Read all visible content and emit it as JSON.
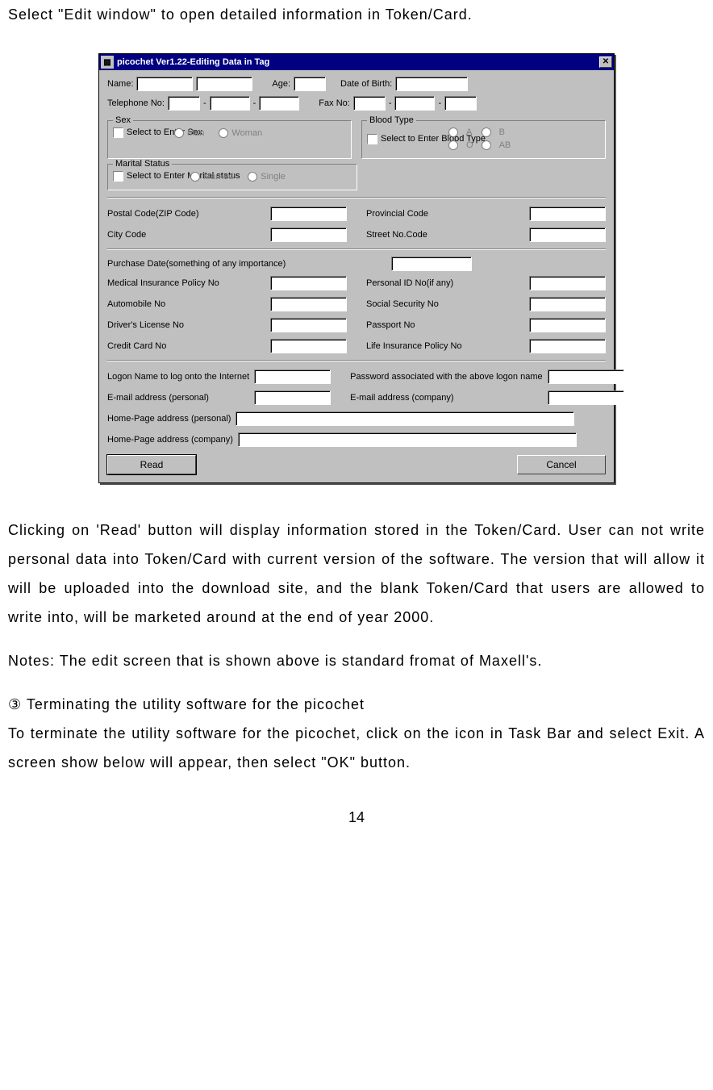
{
  "doc": {
    "intro": "Select \"Edit window\" to open detailed information in Token/Card.",
    "para1": "Clicking on 'Read' button will display information stored in the Token/Card. User can not write personal data into Token/Card with current version of the software. The version that will allow it will be uploaded into the download site, and the blank Token/Card that users are allowed to write into, will be marketed around at the end of year 2000.",
    "notes": "Notes: The edit screen that is shown above is standard fromat of Maxell's.",
    "term_heading": "③ Terminating the utility software for the picochet",
    "term_body": "To terminate the utility software for the picochet, click on the icon in Task Bar and select Exit.  A screen show below will appear, then select \"OK\" button.",
    "page": "14"
  },
  "dialog": {
    "title": "picochet Ver1.22-Editing Data in Tag",
    "labels": {
      "name": "Name:",
      "age": "Age:",
      "dob": "Date of Birth:",
      "tel": "Telephone No:",
      "fax": "Fax No:",
      "sex": "Sex",
      "sex_chk": "Select to Enter Sex",
      "man": "Man",
      "woman": "Woman",
      "blood": "Blood Type",
      "blood_chk": "Select to Enter Blood Type",
      "a": "A",
      "b": "B",
      "o": "O",
      "ab": "AB",
      "marital": "Marital Status",
      "marital_chk": "Select to Enter Marital status",
      "married": "Married",
      "single": "Single",
      "postal": "Postal Code(ZIP Code)",
      "provincial": "Provincial Code",
      "city": "City Code",
      "street": "Street No.Code",
      "purchase": "Purchase Date(something of any importance)",
      "medins": "Medical Insurance Policy No",
      "personalid": "Personal ID No(if any)",
      "auto": "Automobile No",
      "ssn": "Social Security No",
      "driver": "Driver's License No",
      "passport": "Passport No",
      "credit": "Credit Card No",
      "lifeins": "Life Insurance Policy No",
      "logon": "Logon Name to log onto the Internet",
      "password": "Password associated with the above logon name",
      "email_p": "E-mail address (personal)",
      "email_c": "E-mail address (company)",
      "hp_p": "Home-Page address (personal)",
      "hp_c": "Home-Page address (company)"
    },
    "buttons": {
      "read": "Read",
      "cancel": "Cancel"
    }
  }
}
